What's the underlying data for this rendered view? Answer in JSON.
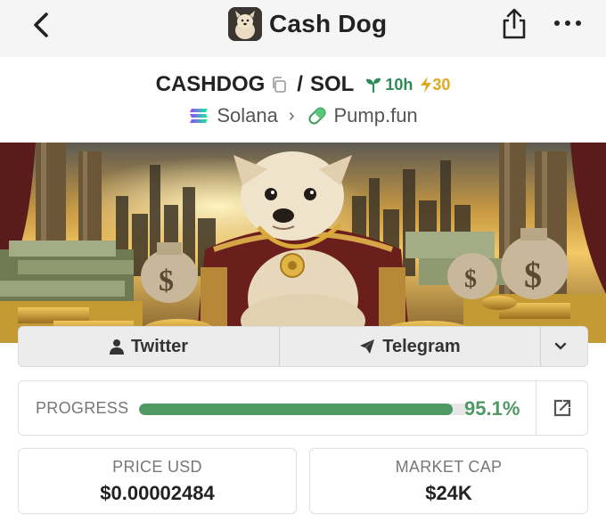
{
  "header": {
    "title": "Cash Dog",
    "back_icon": "chevron-left-icon",
    "share_icon": "share-icon",
    "more_icon": "more-horizontal-icon"
  },
  "pair": {
    "base": "CASHDOG",
    "separator": "/",
    "quote": "SOL",
    "age": "10h",
    "boosts": "30"
  },
  "chain": {
    "network": "Solana",
    "dex": "Pump.fun"
  },
  "social": {
    "twitter_label": "Twitter",
    "telegram_label": "Telegram"
  },
  "progress": {
    "label": "PROGRESS",
    "value_text": "95.1%",
    "fraction": 0.951
  },
  "stats": {
    "price_label": "PRICE USD",
    "price_value": "$0.00002484",
    "mcap_label": "MARKET CAP",
    "mcap_value": "$24K"
  },
  "colors": {
    "accent_green": "#4f9a64",
    "boost_yellow": "#e0a91e"
  }
}
